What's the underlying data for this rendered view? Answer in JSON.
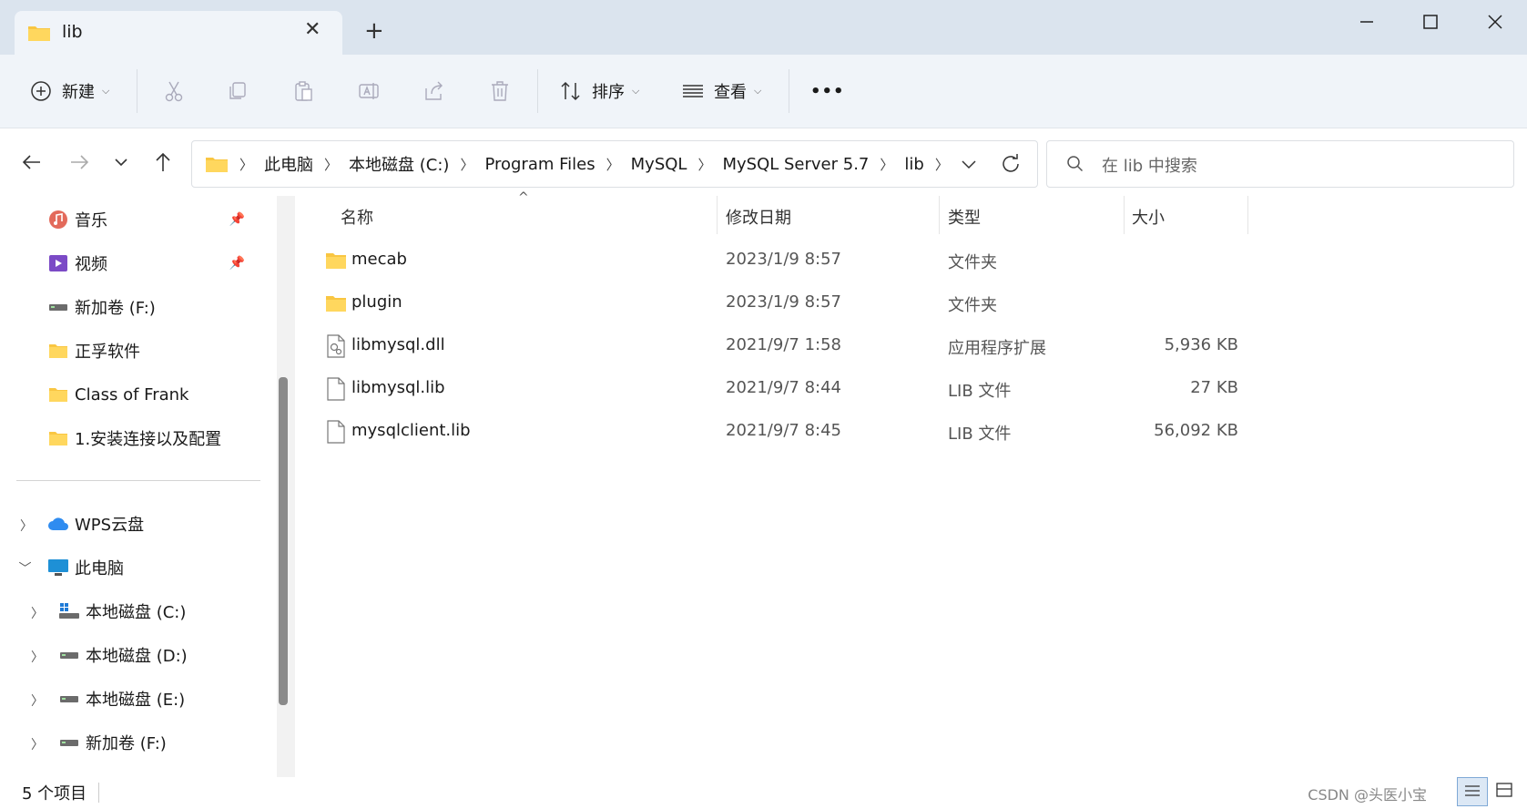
{
  "tab": {
    "title": "lib"
  },
  "toolbar": {
    "new_label": "新建",
    "sort_label": "排序",
    "view_label": "查看",
    "more_label": "•••"
  },
  "address": {
    "crumbs": [
      "此电脑",
      "本地磁盘 (C:)",
      "Program Files",
      "MySQL",
      "MySQL Server 5.7",
      "lib"
    ]
  },
  "search": {
    "placeholder": "在 lib 中搜索"
  },
  "sidebar": {
    "quick": [
      {
        "label": "音乐",
        "icon": "music-icon",
        "pinned": true
      },
      {
        "label": "视频",
        "icon": "video-icon",
        "pinned": true
      },
      {
        "label": "新加卷 (F:)",
        "icon": "drive-icon"
      },
      {
        "label": "正孚软件",
        "icon": "folder-icon"
      },
      {
        "label": "Class of Frank",
        "icon": "folder-icon"
      },
      {
        "label": "1.安装连接以及配置",
        "icon": "folder-icon"
      }
    ],
    "tree": [
      {
        "label": "WPS云盘",
        "icon": "cloud-icon"
      },
      {
        "label": "此电脑",
        "icon": "computer-icon",
        "expanded": true
      },
      {
        "label": "本地磁盘 (C:)",
        "icon": "system-drive-icon",
        "selected": true
      },
      {
        "label": "本地磁盘 (D:)",
        "icon": "drive-icon"
      },
      {
        "label": "本地磁盘 (E:)",
        "icon": "drive-icon"
      },
      {
        "label": "新加卷 (F:)",
        "icon": "drive-icon"
      }
    ]
  },
  "columns": {
    "name": "名称",
    "date": "修改日期",
    "type": "类型",
    "size": "大小"
  },
  "files": [
    {
      "name": "mecab",
      "date": "2023/1/9 8:57",
      "type": "文件夹",
      "size": "",
      "icon": "folder-icon"
    },
    {
      "name": "plugin",
      "date": "2023/1/9 8:57",
      "type": "文件夹",
      "size": "",
      "icon": "folder-icon"
    },
    {
      "name": "libmysql.dll",
      "date": "2021/9/7 1:58",
      "type": "应用程序扩展",
      "size": "5,936 KB",
      "icon": "dll-file-icon"
    },
    {
      "name": "libmysql.lib",
      "date": "2021/9/7 8:44",
      "type": "LIB 文件",
      "size": "27 KB",
      "icon": "file-icon"
    },
    {
      "name": "mysqlclient.lib",
      "date": "2021/9/7 8:45",
      "type": "LIB 文件",
      "size": "56,092 KB",
      "icon": "file-icon"
    }
  ],
  "status": {
    "count": "5 个项目",
    "watermark": "CSDN @头医小宝"
  },
  "colors": {
    "accent": "#0067c0",
    "folder": "#f9c642",
    "selected": "#e5e5e5"
  }
}
